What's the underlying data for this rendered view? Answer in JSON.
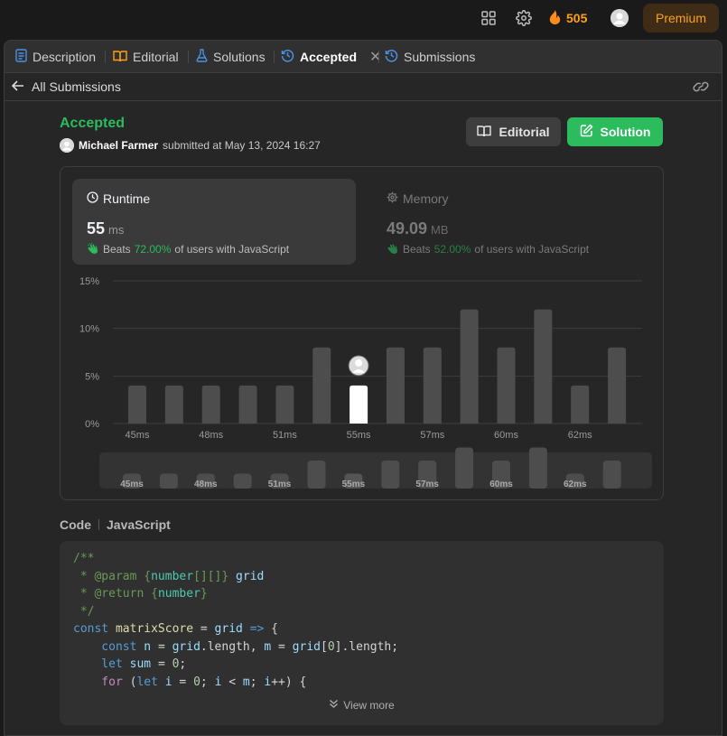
{
  "topbar": {
    "streak_count": "505",
    "premium_label": "Premium",
    "icons": [
      "layout-grid-icon",
      "gear-icon",
      "flame-icon",
      "avatar"
    ]
  },
  "tabs": [
    {
      "label": "Description",
      "icon": "document-icon",
      "icon_color": "#4a90e2"
    },
    {
      "label": "Editorial",
      "icon": "book-icon",
      "icon_color": "#ffa116"
    },
    {
      "label": "Solutions",
      "icon": "flask-icon",
      "icon_color": "#4a90e2"
    },
    {
      "label": "Accepted",
      "icon": "history-icon",
      "icon_color": "#4a90e2"
    },
    {
      "label": "Submissions",
      "icon": "history-icon",
      "icon_color": "#4a90e2"
    }
  ],
  "subbar": {
    "back_label": "All Submissions"
  },
  "submission": {
    "status": "Accepted",
    "user": "Michael Farmer",
    "submitted_text": "submitted at May 13, 2024 16:27",
    "editorial_button": "Editorial",
    "solution_button": "Solution"
  },
  "runtime": {
    "title": "Runtime",
    "value": "55",
    "unit": "ms",
    "beats_label": "Beats",
    "beats_pct": "72.00%",
    "beats_suffix": "of users with JavaScript"
  },
  "memory": {
    "title": "Memory",
    "value": "49.09",
    "unit": "MB",
    "beats_label": "Beats",
    "beats_pct": "52.00%",
    "beats_suffix": "of users with JavaScript"
  },
  "chart_data": {
    "type": "bar",
    "y_tick_labels": [
      "15%",
      "10%",
      "5%",
      "0%"
    ],
    "ylim": [
      0,
      15
    ],
    "x_tick_labels": [
      "45ms",
      "48ms",
      "51ms",
      "55ms",
      "57ms",
      "60ms",
      "62ms"
    ],
    "bars": [
      {
        "value": 4,
        "highlight": false
      },
      {
        "value": 4,
        "highlight": false
      },
      {
        "value": 4,
        "highlight": false
      },
      {
        "value": 4,
        "highlight": false
      },
      {
        "value": 4,
        "highlight": false
      },
      {
        "value": 8,
        "highlight": false
      },
      {
        "value": 4,
        "highlight": true
      },
      {
        "value": 8,
        "highlight": false
      },
      {
        "value": 8,
        "highlight": false
      },
      {
        "value": 12,
        "highlight": false
      },
      {
        "value": 8,
        "highlight": false
      },
      {
        "value": 12,
        "highlight": false
      },
      {
        "value": 4,
        "highlight": false
      },
      {
        "value": 8,
        "highlight": false
      }
    ],
    "colors": {
      "bar": "#4d4d4d",
      "highlight": "#ffffff",
      "grid": "#3d3d3d"
    }
  },
  "code": {
    "label": "Code",
    "language": "JavaScript",
    "view_more": "View more",
    "lines": [
      [
        {
          "t": "/**",
          "c": "#6a9955"
        }
      ],
      [
        {
          "t": " * ",
          "c": "#6a9955"
        },
        {
          "t": "@param",
          "c": "#6a9955"
        },
        {
          "t": " {",
          "c": "#6a9955"
        },
        {
          "t": "number",
          "c": "#4ec9b0"
        },
        {
          "t": "[][]",
          "c": "#6a9955"
        },
        {
          "t": "} ",
          "c": "#6a9955"
        },
        {
          "t": "grid",
          "c": "#9cdcfe"
        }
      ],
      [
        {
          "t": " * ",
          "c": "#6a9955"
        },
        {
          "t": "@return",
          "c": "#6a9955"
        },
        {
          "t": " {",
          "c": "#6a9955"
        },
        {
          "t": "number",
          "c": "#4ec9b0"
        },
        {
          "t": "}",
          "c": "#6a9955"
        }
      ],
      [
        {
          "t": " */",
          "c": "#6a9955"
        }
      ],
      [
        {
          "t": "const",
          "c": "#569cd6"
        },
        {
          "t": " matrixScore ",
          "c": "#dcdcaa"
        },
        {
          "t": "= ",
          "c": "#d4d4d4"
        },
        {
          "t": "grid",
          "c": "#9cdcfe"
        },
        {
          "t": " => ",
          "c": "#569cd6"
        },
        {
          "t": "{",
          "c": "#d4d4d4"
        }
      ],
      [
        {
          "t": "    const",
          "c": "#569cd6"
        },
        {
          "t": " n ",
          "c": "#9cdcfe"
        },
        {
          "t": "= ",
          "c": "#d4d4d4"
        },
        {
          "t": "grid",
          "c": "#9cdcfe"
        },
        {
          "t": ".length, ",
          "c": "#d4d4d4"
        },
        {
          "t": "m",
          "c": "#9cdcfe"
        },
        {
          "t": " = ",
          "c": "#d4d4d4"
        },
        {
          "t": "grid",
          "c": "#9cdcfe"
        },
        {
          "t": "[",
          "c": "#d4d4d4"
        },
        {
          "t": "0",
          "c": "#b5cea8"
        },
        {
          "t": "].length;",
          "c": "#d4d4d4"
        }
      ],
      [
        {
          "t": "    let",
          "c": "#569cd6"
        },
        {
          "t": " sum ",
          "c": "#9cdcfe"
        },
        {
          "t": "= ",
          "c": "#d4d4d4"
        },
        {
          "t": "0",
          "c": "#b5cea8"
        },
        {
          "t": ";",
          "c": "#d4d4d4"
        }
      ],
      [
        {
          "t": "    for",
          "c": "#c586c0"
        },
        {
          "t": " (",
          "c": "#d4d4d4"
        },
        {
          "t": "let",
          "c": "#569cd6"
        },
        {
          "t": " i ",
          "c": "#9cdcfe"
        },
        {
          "t": "= ",
          "c": "#d4d4d4"
        },
        {
          "t": "0",
          "c": "#b5cea8"
        },
        {
          "t": "; ",
          "c": "#d4d4d4"
        },
        {
          "t": "i",
          "c": "#9cdcfe"
        },
        {
          "t": " < ",
          "c": "#d4d4d4"
        },
        {
          "t": "m",
          "c": "#9cdcfe"
        },
        {
          "t": "; ",
          "c": "#d4d4d4"
        },
        {
          "t": "i",
          "c": "#9cdcfe"
        },
        {
          "t": "++) {",
          "c": "#d4d4d4"
        }
      ]
    ]
  }
}
